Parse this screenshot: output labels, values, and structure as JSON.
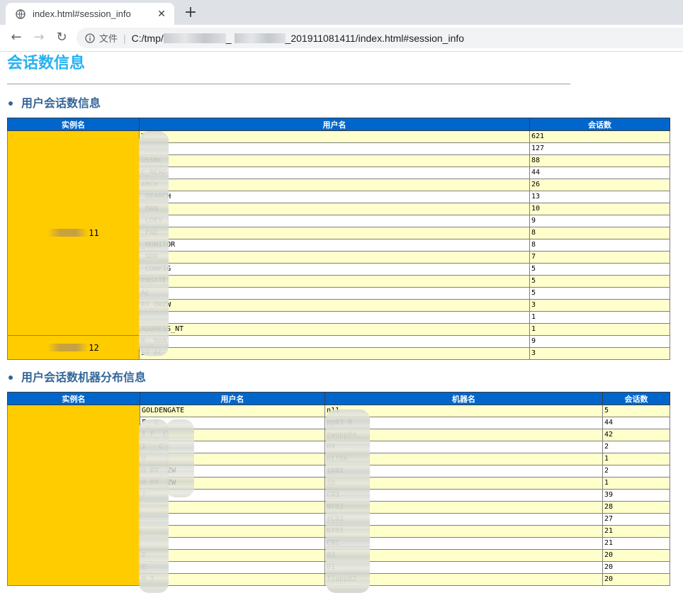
{
  "browser": {
    "tab_title": "index.html#session_info",
    "close_glyph": "✕",
    "newtab_glyph": "+",
    "back_glyph": "←",
    "forward_glyph": "→",
    "reload_glyph": "↻",
    "scheme_label": "文件",
    "url_prefix": "C:/tmp/",
    "url_mid": "_",
    "url_suffix": "_201911081411/index.html#session_info"
  },
  "page": {
    "title": "会话数信息",
    "section1": "用户会话数信息",
    "section2": "用户会话数机器分布信息"
  },
  "table1": {
    "headers": [
      "实例名",
      "用户名",
      "会话数"
    ],
    "instances": [
      "11",
      "12"
    ],
    "rows": [
      {
        "user": "T",
        "count": "621"
      },
      {
        "user": "",
        "count": "127"
      },
      {
        "user": "OSSBC",
        "count": "88"
      },
      {
        "user": "C_READ",
        "count": "44"
      },
      {
        "user": "ARCH",
        "count": "26"
      },
      {
        "user": "_SEARCH",
        "count": "13"
      },
      {
        "user": "_MAN",
        "count": "10"
      },
      {
        "user": "_LDEV",
        "count": "9"
      },
      {
        "user": "_PAD",
        "count": "8"
      },
      {
        "user": "_MONITOR",
        "count": "8"
      },
      {
        "user": "_NBR",
        "count": "7"
      },
      {
        "user": "_CONFIG",
        "count": "5"
      },
      {
        "user": "ENGATE",
        "count": "5"
      },
      {
        "user": "AC",
        "count": "5"
      },
      {
        "user": "RY_QWZW",
        "count": "3"
      },
      {
        "user": "",
        "count": "1"
      },
      {
        "user": "ADDRESS_NT",
        "count": "1"
      },
      {
        "user": "R   _MAN",
        "count": "9"
      },
      {
        "user": "SY  AC",
        "count": "3"
      }
    ]
  },
  "table2": {
    "headers": [
      "实例名",
      "用户名",
      "机器名",
      "会话数"
    ],
    "rows": [
      {
        "user": "GOLDENGATE",
        "machine": "n11",
        "count": "5"
      },
      {
        "user": "F_   C",
        "machine": "pp03-0",
        "count": "44"
      },
      {
        "user": "I F_   C",
        "machine": "ewapp04",
        "count": "42"
      },
      {
        "user": "I _   C",
        "machine": "04",
        "count": "2"
      },
      {
        "user": "O",
        "machine": "ntf06",
        "count": "1"
      },
      {
        "user": "O RY_ ZW",
        "machine": "ib01",
        "count": "2"
      },
      {
        "user": "O RY_ ZW",
        "machine": "ib",
        "count": "1"
      },
      {
        "user": "T",
        "machine": "C03",
        "count": "39"
      },
      {
        "user": "",
        "machine": "NT02",
        "count": "28"
      },
      {
        "user": "",
        "machine": "rC02",
        "count": "27"
      },
      {
        "user": "",
        "machine": "NT01",
        "count": "21"
      },
      {
        "user": "",
        "machine": "C01",
        "count": "21"
      },
      {
        "user": "E",
        "machine": "03",
        "count": "20"
      },
      {
        "user": "E",
        "machine": "01",
        "count": "20"
      },
      {
        "user": "R   T",
        "machine": "fjapp02",
        "count": "20"
      }
    ]
  }
}
